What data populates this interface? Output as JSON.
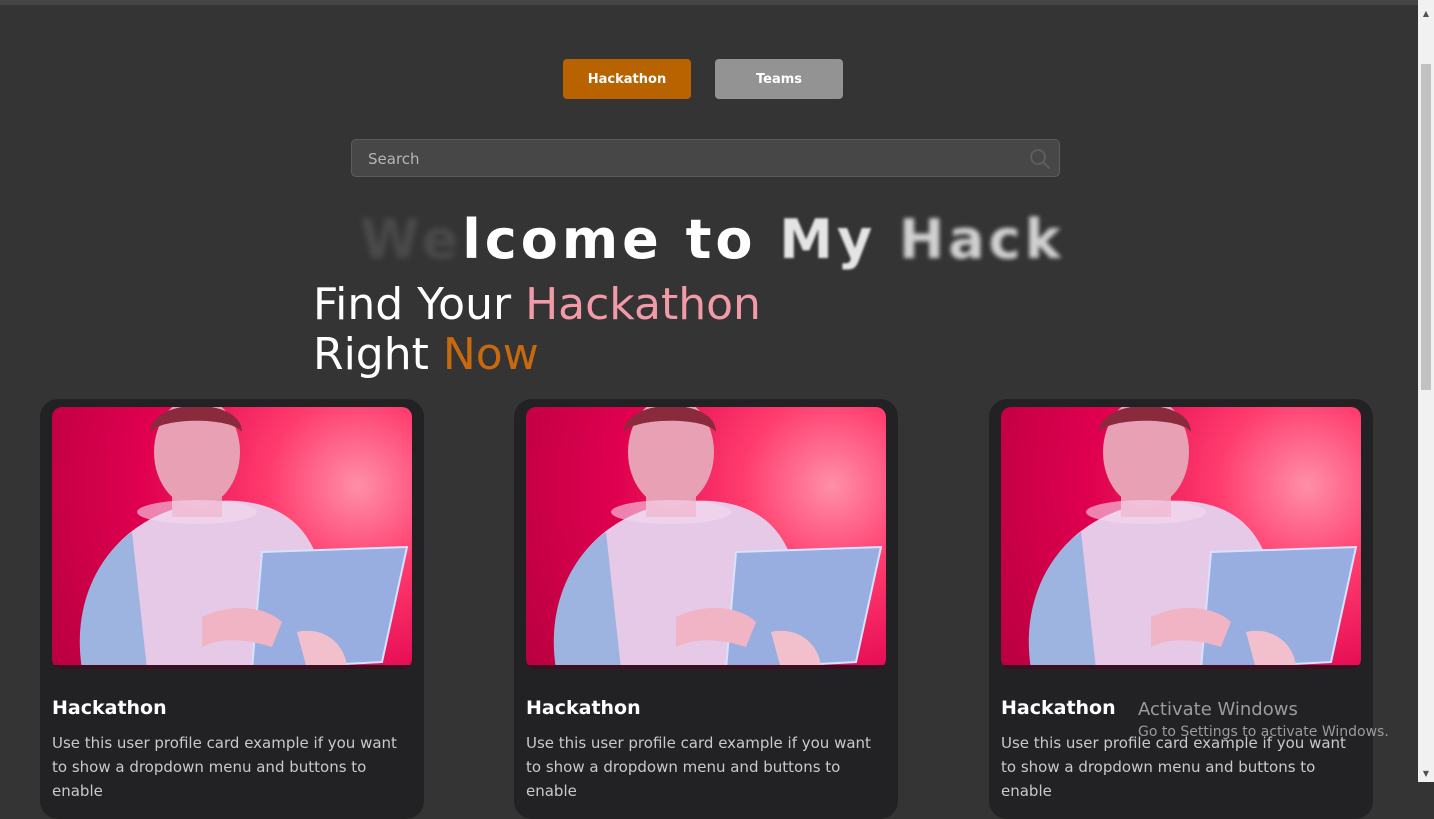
{
  "tabs": [
    {
      "label": "Hackathon",
      "active": true
    },
    {
      "label": "Teams",
      "active": false
    }
  ],
  "search": {
    "placeholder": "Search",
    "value": ""
  },
  "marquee": {
    "faded_start": "We",
    "clear": "lcome to ",
    "soft": "My ",
    "blurred_end": "Hack"
  },
  "headline": {
    "line1_prefix": "Find Your ",
    "line1_highlight": "Hackathon",
    "line2_prefix": "Right ",
    "line2_highlight": "Now"
  },
  "cards": [
    {
      "title": "Hackathon",
      "text": "Use this user profile card example if you want to show a dropdown menu and buttons to enable"
    },
    {
      "title": "Hackathon",
      "text": "Use this user profile card example if you want to show a dropdown menu and buttons to enable"
    },
    {
      "title": "Hackathon",
      "text": "Use this user profile card example if you want to show a dropdown menu and buttons to enable"
    }
  ],
  "watermark": {
    "title": "Activate Windows",
    "subtitle": "Go to Settings to activate Windows."
  },
  "colors": {
    "accent": "#b86200",
    "secondary_button": "#939393",
    "highlight_pink": "#f29aa8",
    "highlight_orange": "#c7690f",
    "background": "#343434"
  }
}
